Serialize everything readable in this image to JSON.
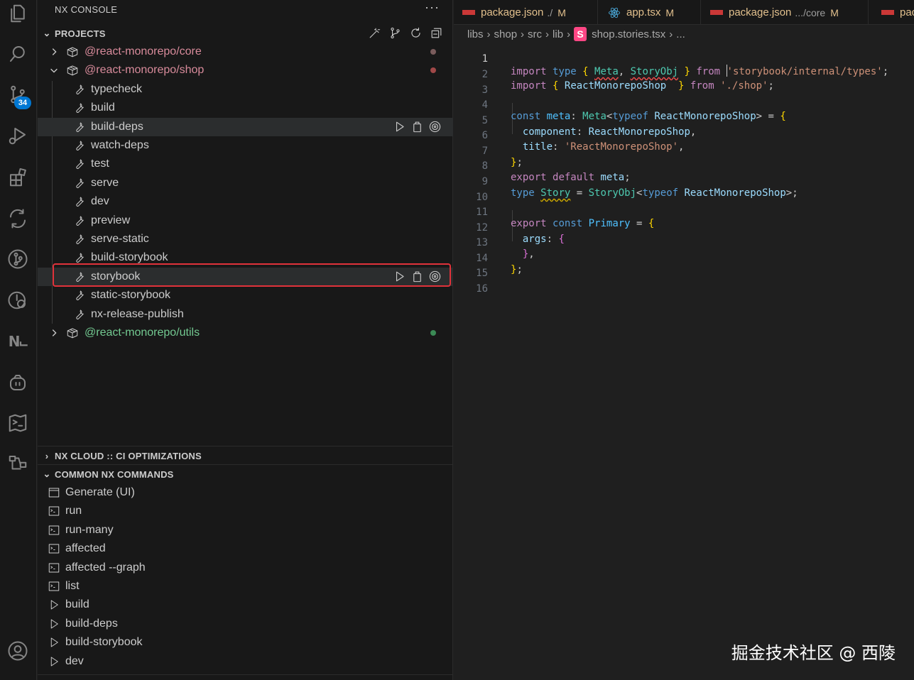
{
  "sidebar": {
    "title": "NX CONSOLE",
    "more": "···",
    "projects_header": "PROJECTS",
    "projects": [
      {
        "label": "@react-monorepo/core",
        "status_color": "#7a5c5c",
        "expanded": false
      },
      {
        "label": "@react-monorepo/shop",
        "status_color": "#a04848",
        "expanded": true
      },
      {
        "label": "@react-monorepo/utils",
        "status_color": "#3b8a55",
        "expanded": false
      }
    ],
    "targets": [
      "typecheck",
      "build",
      "build-deps",
      "watch-deps",
      "test",
      "serve",
      "dev",
      "preview",
      "serve-static",
      "build-storybook",
      "storybook",
      "static-storybook",
      "nx-release-publish"
    ],
    "cloud_header": "NX CLOUD :: CI OPTIMIZATIONS",
    "commands_header": "COMMON NX COMMANDS",
    "commands": [
      {
        "label": "Generate (UI)",
        "icon": "window-icon"
      },
      {
        "label": "run",
        "icon": "terminal-icon"
      },
      {
        "label": "run-many",
        "icon": "terminal-icon"
      },
      {
        "label": "affected",
        "icon": "terminal-icon"
      },
      {
        "label": "affected --graph",
        "icon": "terminal-icon"
      },
      {
        "label": "list",
        "icon": "terminal-icon"
      },
      {
        "label": "build",
        "icon": "play-icon"
      },
      {
        "label": "build-deps",
        "icon": "play-icon"
      },
      {
        "label": "build-storybook",
        "icon": "play-icon"
      },
      {
        "label": "dev",
        "icon": "play-icon"
      }
    ]
  },
  "activity_bar": {
    "scm_badge": "34",
    "nx_label": "N⨽"
  },
  "tabs": [
    {
      "name": "package.json",
      "desc": "./",
      "mod": "M"
    },
    {
      "name": "app.tsx",
      "desc": "",
      "mod": "M"
    },
    {
      "name": "package.json",
      "desc": ".../core",
      "mod": "M"
    },
    {
      "name": "pac",
      "desc": "",
      "mod": ""
    }
  ],
  "breadcrumb": {
    "parts": [
      "libs",
      "shop",
      "src",
      "lib"
    ],
    "file": "shop.stories.tsx",
    "icon_letter": "S",
    "tail": "..."
  },
  "editor": {
    "line_numbers": [
      "1",
      "2",
      "3",
      "4",
      "5",
      "6",
      "7",
      "8",
      "9",
      "10",
      "11",
      "12",
      "13",
      "14",
      "15",
      "16"
    ]
  },
  "watermark": "掘金技术社区 @ 西陵"
}
